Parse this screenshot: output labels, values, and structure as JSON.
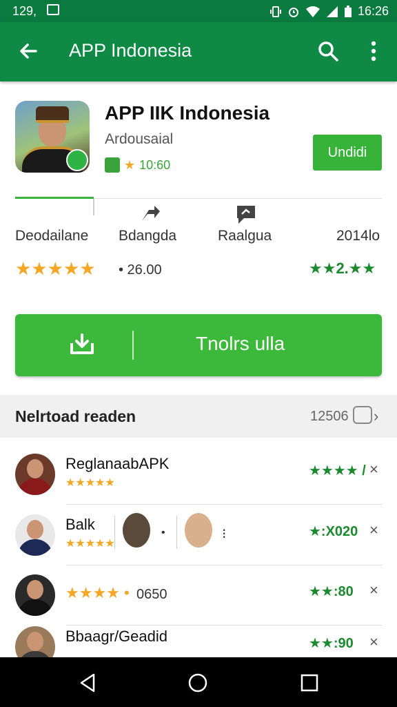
{
  "statusbar": {
    "time_left": "129,",
    "time_right": "16:26"
  },
  "appbar": {
    "title": "APP Indonesia"
  },
  "app": {
    "name": "APP IIK Indonesia",
    "developer": "Ardousaial",
    "meta_value": "10:60",
    "install_small": "Undidi"
  },
  "stats": [
    {
      "label": "Deodailane"
    },
    {
      "label": "Bdangda"
    },
    {
      "label": "Raalgua"
    },
    {
      "label": "2014lo"
    }
  ],
  "rating": {
    "stars": "★★★★★",
    "value": "• 26.00",
    "right": "★★2.★★"
  },
  "install_big": {
    "label": "Tnolrs ulla"
  },
  "section": {
    "title": "Nelrtoad readen",
    "count": "12506",
    "chevron": "›"
  },
  "list": [
    {
      "name": "ReglanaabAPK",
      "stars": "★★★★★",
      "right": "★★★★ /",
      "x": "×"
    },
    {
      "name": "Balk",
      "stars": "★★★★★",
      "right": "★:X020",
      "x": "×",
      "extra_dot_1": "•",
      "extra_dot_2": "⁝"
    },
    {
      "name": "",
      "stars": "★★★★ •",
      "value": "0650",
      "right": "★★:80",
      "x": "×"
    },
    {
      "name": "Bbaagr/Geadid",
      "stars": "",
      "right": "★★:90",
      "x": "×"
    }
  ],
  "colors": {
    "appbar": "#0f8a44",
    "statusbar": "#0b7a3f",
    "accent": "#3cb93a",
    "star": "#f5a623",
    "star_green": "#1b8a2e"
  }
}
